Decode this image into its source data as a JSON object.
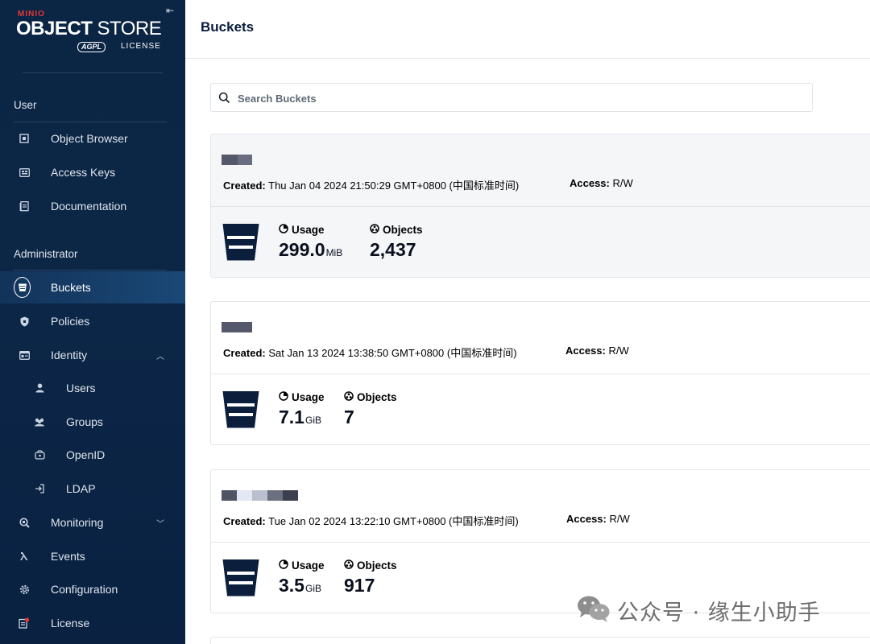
{
  "app": {
    "brand_small": "MINIO",
    "brand_bold": "OBJECT",
    "brand_light": " STORE",
    "license_badge": "AGPL",
    "license_label": "LICENSE"
  },
  "sidebar": {
    "section_user": "User",
    "section_admin": "Administrator",
    "items": {
      "object_browser": "Object Browser",
      "access_keys": "Access Keys",
      "documentation": "Documentation",
      "buckets": "Buckets",
      "policies": "Policies",
      "identity": "Identity",
      "users": "Users",
      "groups": "Groups",
      "openid": "OpenID",
      "ldap": "LDAP",
      "monitoring": "Monitoring",
      "events": "Events",
      "configuration": "Configuration",
      "license": "License"
    }
  },
  "header": {
    "title": "Buckets"
  },
  "search": {
    "placeholder": "Search Buckets",
    "value": ""
  },
  "buckets": [
    {
      "created_label": "Created:",
      "created": " Thu Jan 04 2024 21:50:29 GMT+0800 (中国标准时间)",
      "access_label": "Access:",
      "access": " R/W",
      "usage_label": "Usage",
      "usage_value": "299.0",
      "usage_unit": "MiB",
      "objects_label": "Objects",
      "objects_value": "2,437"
    },
    {
      "created_label": "Created:",
      "created": " Sat Jan 13 2024 13:38:50 GMT+0800 (中国标准时间)",
      "access_label": "Access:",
      "access": " R/W",
      "usage_label": "Usage",
      "usage_value": "7.1",
      "usage_unit": "GiB",
      "objects_label": "Objects",
      "objects_value": "7"
    },
    {
      "created_label": "Created:",
      "created": " Tue Jan 02 2024 13:22:10 GMT+0800 (中国标准时间)",
      "access_label": "Access:",
      "access": " R/W",
      "usage_label": "Usage",
      "usage_value": "3.5",
      "usage_unit": "GiB",
      "objects_label": "Objects",
      "objects_value": "917"
    }
  ],
  "watermark": {
    "text": "公众号 · 缘生小助手"
  },
  "colors": {
    "sidebar_bg": "#0b2544",
    "active_item": "#1a4876",
    "text_dark": "#081c3b",
    "brand_red": "#e53935"
  }
}
